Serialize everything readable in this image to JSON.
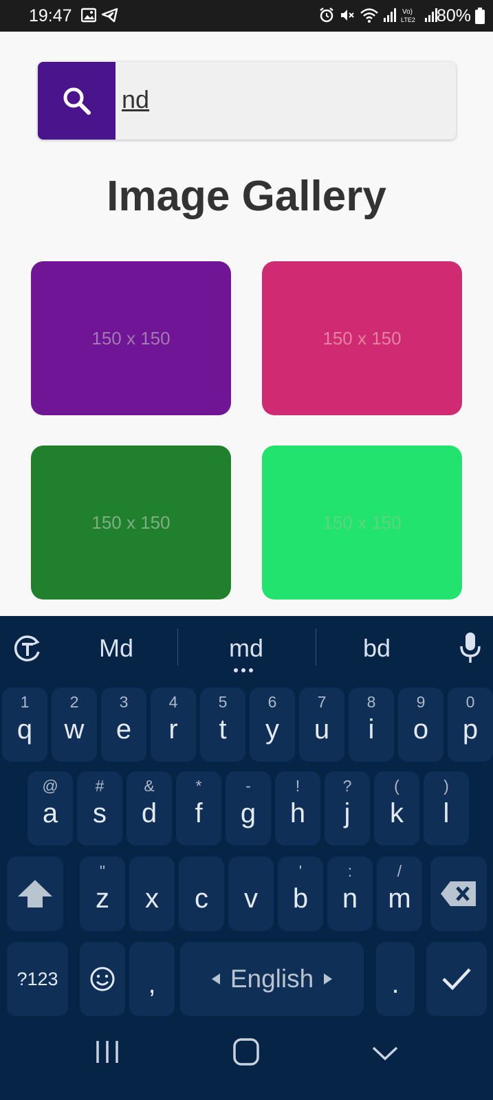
{
  "status_bar": {
    "time": "19:47",
    "battery": "80%"
  },
  "search": {
    "value": "nd"
  },
  "page_title": "Image Gallery",
  "gallery": [
    {
      "label": "150 x 150",
      "color": "#6f1595"
    },
    {
      "label": "150 x 150",
      "color": "#d02a73"
    },
    {
      "label": "150 x 150",
      "color": "#20802d"
    },
    {
      "label": "150 x 150",
      "color": "#22e36d"
    }
  ],
  "keyboard": {
    "suggestions": [
      "Md",
      "md",
      "bd"
    ],
    "row1": [
      {
        "key": "q",
        "hint": "1"
      },
      {
        "key": "w",
        "hint": "2"
      },
      {
        "key": "e",
        "hint": "3"
      },
      {
        "key": "r",
        "hint": "4"
      },
      {
        "key": "t",
        "hint": "5"
      },
      {
        "key": "y",
        "hint": "6"
      },
      {
        "key": "u",
        "hint": "7"
      },
      {
        "key": "i",
        "hint": "8"
      },
      {
        "key": "o",
        "hint": "9"
      },
      {
        "key": "p",
        "hint": "0"
      }
    ],
    "row2": [
      {
        "key": "a",
        "hint": "@"
      },
      {
        "key": "s",
        "hint": "#"
      },
      {
        "key": "d",
        "hint": "&"
      },
      {
        "key": "f",
        "hint": "*"
      },
      {
        "key": "g",
        "hint": "-"
      },
      {
        "key": "h",
        "hint": "!"
      },
      {
        "key": "j",
        "hint": "?"
      },
      {
        "key": "k",
        "hint": "("
      },
      {
        "key": "l",
        "hint": ")"
      }
    ],
    "row3": [
      {
        "key": "z",
        "hint": "\""
      },
      {
        "key": "x",
        "hint": ""
      },
      {
        "key": "c",
        "hint": ""
      },
      {
        "key": "v",
        "hint": ""
      },
      {
        "key": "b",
        "hint": "'"
      },
      {
        "key": "n",
        "hint": ":"
      },
      {
        "key": "m",
        "hint": "/"
      }
    ],
    "symbols_label": "?123",
    "comma": ",",
    "space_label": "English",
    "period": "."
  }
}
